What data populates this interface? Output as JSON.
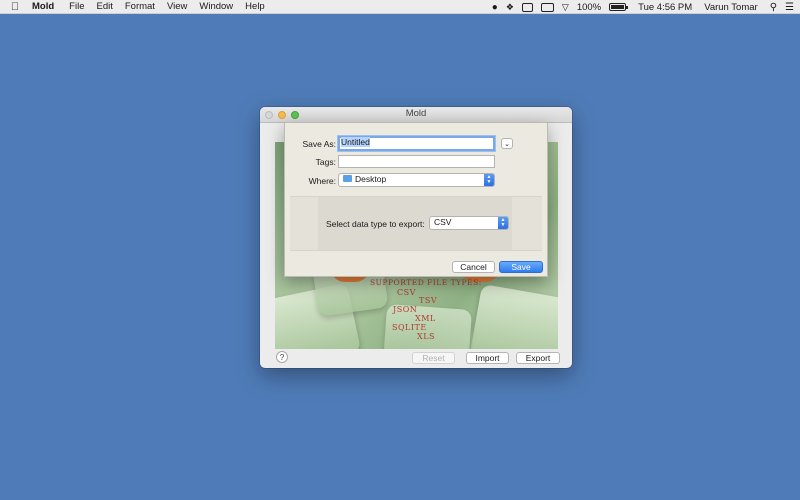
{
  "menubar": {
    "app_name": "Mold",
    "items": [
      "File",
      "Edit",
      "Format",
      "View",
      "Window",
      "Help"
    ],
    "battery": "100%",
    "clock": "Tue 4:56 PM",
    "user": "Varun Tomar",
    "status_icons": [
      "bubble-icon",
      "dropbox-icon",
      "box-icon",
      "display-icon",
      "wifi-icon",
      "battery-icon",
      "spotlight-icon",
      "list-icon"
    ]
  },
  "window": {
    "title": "Mold",
    "artwork_text": {
      "header": "SUPPORTED FILE TYPES:",
      "types": [
        "CSV",
        "TSV",
        "JSON",
        "XML",
        "SQLITE",
        "XLS"
      ]
    },
    "help_label": "?",
    "buttons": {
      "reset": "Reset",
      "import": "Import",
      "export": "Export"
    }
  },
  "save_sheet": {
    "save_as_label": "Save As:",
    "save_as_value": "Untitled",
    "tags_label": "Tags:",
    "tags_value": "",
    "where_label": "Where:",
    "where_value": "Desktop",
    "data_type_label": "Select data type to export:",
    "data_type_value": "CSV",
    "cancel_label": "Cancel",
    "save_label": "Save"
  },
  "colors": {
    "desktop": "#4f7cb8",
    "accent": "#2e7cf2",
    "artwork_text": "#b03a2e"
  }
}
